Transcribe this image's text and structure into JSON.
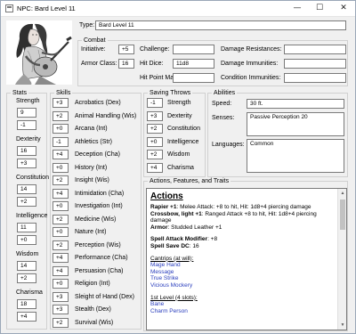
{
  "window": {
    "title": "NPC: Bard Level 11",
    "minimize": "—",
    "maximize": "☐",
    "close": "✕"
  },
  "portrait": {
    "icon": "bard-portrait-image"
  },
  "type": {
    "label": "Type:",
    "value": "Bard Level 11"
  },
  "combat": {
    "title": "Combat",
    "initiative_label": "Initiative:",
    "initiative": "+5",
    "armor_class_label": "Armor Class:",
    "armor_class": "16",
    "challenge_label": "Challenge:",
    "challenge": "",
    "hit_dice_label": "Hit Dice:",
    "hit_dice": "11d8",
    "hp_max_label": "Hit Point Max:",
    "hp_max": "",
    "damage_resistances_label": "Damage Resistances:",
    "damage_resistances": "",
    "damage_immunities_label": "Damage Immunities:",
    "damage_immunities": "",
    "condition_immunities_label": "Condition Immunities:",
    "condition_immunities": ""
  },
  "stats": {
    "title": "Stats",
    "items": [
      {
        "label": "Strength",
        "score": "9",
        "mod": "-1"
      },
      {
        "label": "Dexterity",
        "score": "16",
        "mod": "+3"
      },
      {
        "label": "Constitution",
        "score": "14",
        "mod": "+2"
      },
      {
        "label": "Intelligence",
        "score": "11",
        "mod": "+0"
      },
      {
        "label": "Wisdom",
        "score": "14",
        "mod": "+2"
      },
      {
        "label": "Charisma",
        "score": "18",
        "mod": "+4"
      }
    ]
  },
  "skills": {
    "title": "Skills",
    "items": [
      {
        "value": "+3",
        "label": "Acrobatics (Dex)"
      },
      {
        "value": "+2",
        "label": "Animal Handling (Wis)"
      },
      {
        "value": "+0",
        "label": "Arcana (Int)"
      },
      {
        "value": "-1",
        "label": "Athletics (Str)"
      },
      {
        "value": "+4",
        "label": "Deception (Cha)"
      },
      {
        "value": "+0",
        "label": "History (Int)"
      },
      {
        "value": "+2",
        "label": "Insight (Wis)"
      },
      {
        "value": "+4",
        "label": "Intimidation (Cha)"
      },
      {
        "value": "+0",
        "label": "Investigation (Int)"
      },
      {
        "value": "+2",
        "label": "Medicine (Wis)"
      },
      {
        "value": "+0",
        "label": "Nature (Int)"
      },
      {
        "value": "+2",
        "label": "Perception (Wis)"
      },
      {
        "value": "+4",
        "label": "Performance (Cha)"
      },
      {
        "value": "+4",
        "label": "Persuasion (Cha)"
      },
      {
        "value": "+0",
        "label": "Religion (Int)"
      },
      {
        "value": "+3",
        "label": "Sleight of Hand (Dex)"
      },
      {
        "value": "+3",
        "label": "Stealth (Dex)"
      },
      {
        "value": "+2",
        "label": "Survival (Wis)"
      }
    ]
  },
  "saving_throws": {
    "title": "Saving Throws",
    "items": [
      {
        "value": "-1",
        "label": "Strength"
      },
      {
        "value": "+3",
        "label": "Dexterity"
      },
      {
        "value": "+2",
        "label": "Constitution"
      },
      {
        "value": "+0",
        "label": "Intelligence"
      },
      {
        "value": "+2",
        "label": "Wisdom"
      },
      {
        "value": "+4",
        "label": "Charisma"
      }
    ]
  },
  "abilities": {
    "title": "Abilities",
    "speed_label": "Speed:",
    "speed": "30 ft.",
    "senses_label": "Senses:",
    "senses": "Passive Perception 20",
    "languages_label": "Languages:",
    "languages": "Common"
  },
  "actions": {
    "title": "Actions, Features, and Traits",
    "heading": "Actions",
    "rapier_name": "Rapier +1",
    "rapier_text": ": Melee Attack: +8 to hit, Hit: 1d8+4 piercing damage",
    "crossbow_name": "Crossbow, light +1",
    "crossbow_text": ": Ranged Attack +8 to hit, Hit: 1d8+4 piercing damage",
    "armor_name": "Armor",
    "armor_text": ": Studded Leather +1",
    "spell_attack_name": "Spell Attack Modifier",
    "spell_attack_text": ": +8",
    "spell_dc_name": "Spell Save DC",
    "spell_dc_text": ": 16",
    "cantrips_header": "Cantrips (at will):",
    "cantrips": [
      "Mage Hand",
      "Message",
      "True Strike",
      "Vicious Mockery"
    ],
    "level1_header": "1st Level (4 slots):",
    "level1": [
      "Bane",
      "Charm Person"
    ]
  }
}
